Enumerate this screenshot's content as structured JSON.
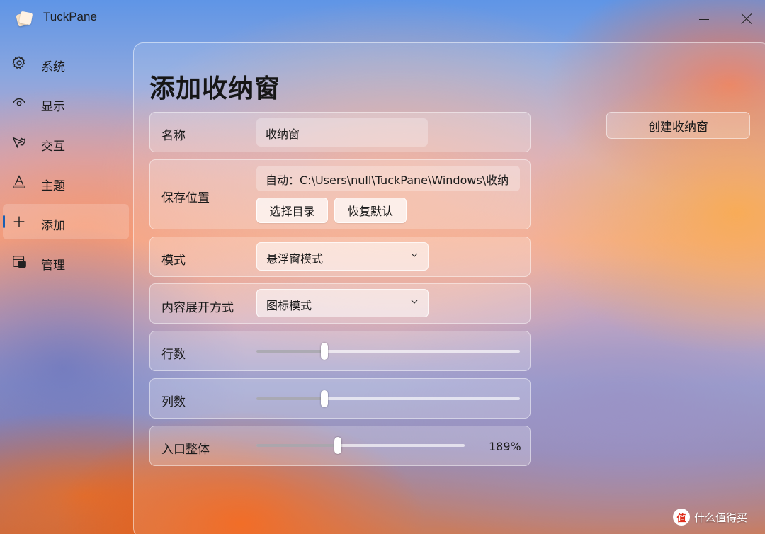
{
  "app": {
    "title": "TuckPane"
  },
  "sidebar": {
    "items": [
      {
        "label": "系统",
        "icon": "gear-icon",
        "active": false
      },
      {
        "label": "显示",
        "icon": "eye-icon",
        "active": false
      },
      {
        "label": "交互",
        "icon": "pointer-hand-icon",
        "active": false
      },
      {
        "label": "主题",
        "icon": "theme-icon",
        "active": false
      },
      {
        "label": "添加",
        "icon": "plus-icon",
        "active": true
      },
      {
        "label": "管理",
        "icon": "manage-icon",
        "active": false
      }
    ]
  },
  "page": {
    "title": "添加收纳窗",
    "create_button": "创建收纳窗"
  },
  "form": {
    "name": {
      "label": "名称",
      "value": "收纳窗"
    },
    "location": {
      "label": "保存位置",
      "value": "自动：C:\\Users\\null\\TuckPane\\Windows\\收纳",
      "choose_button": "选择目录",
      "reset_button": "恢复默认"
    },
    "mode": {
      "label": "模式",
      "value": "悬浮窗模式"
    },
    "expand": {
      "label": "内容展开方式",
      "value": "图标模式"
    },
    "rows": {
      "label": "行数",
      "fraction": 0.257
    },
    "cols": {
      "label": "列数",
      "fraction": 0.257
    },
    "scale": {
      "label": "入口整体",
      "fraction": 0.39,
      "value_text": "189%"
    }
  },
  "watermark": {
    "logo_text": "值",
    "text": "什么值得买"
  },
  "colors": {
    "accent": "#1a5fb4"
  }
}
